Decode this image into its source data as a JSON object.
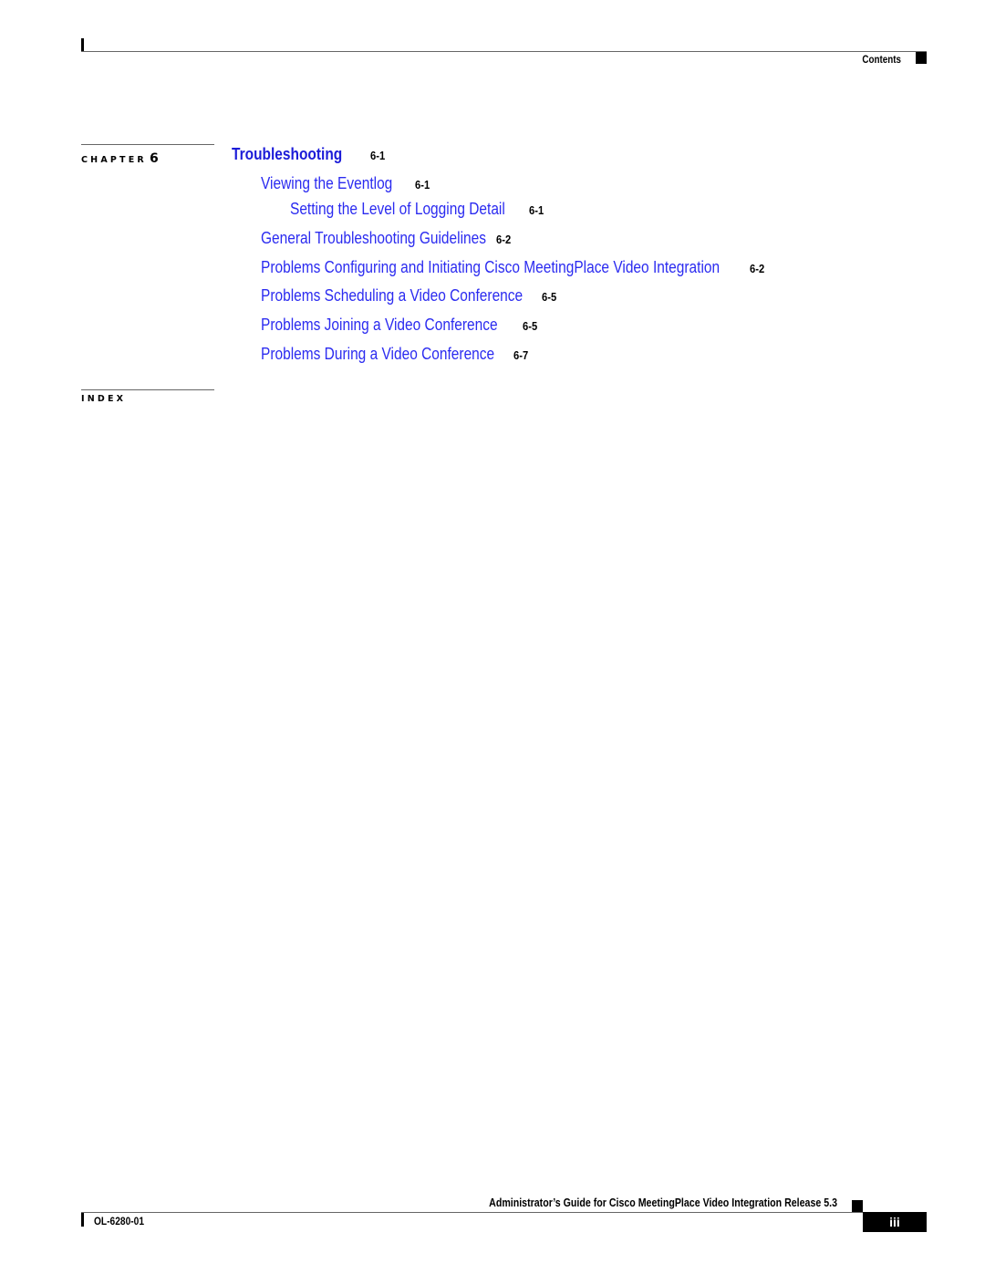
{
  "header": {
    "section_label": "Contents"
  },
  "chapter": {
    "label": "CHAPTER",
    "number": "6"
  },
  "toc": [
    {
      "level": 0,
      "title": "Troubleshooting",
      "page": "6-1"
    },
    {
      "level": 1,
      "title": "Viewing the Eventlog",
      "page": "6-1"
    },
    {
      "level": 2,
      "title": "Setting the Level of Logging Detail",
      "page": "6-1"
    },
    {
      "level": 1,
      "title": "General Troubleshooting Guidelines",
      "page": "6-2"
    },
    {
      "level": 1,
      "title": "Problems Configuring and Initiating Cisco MeetingPlace Video Integration",
      "page": "6-2"
    },
    {
      "level": 1,
      "title": "Problems Scheduling a Video Conference",
      "page": "6-5"
    },
    {
      "level": 1,
      "title": "Problems Joining a Video Conference",
      "page": "6-5"
    },
    {
      "level": 1,
      "title": "Problems During a Video Conference",
      "page": "6-7"
    }
  ],
  "index": {
    "label": "INDEX"
  },
  "footer": {
    "guide_title": "Administrator’s Guide for Cisco MeetingPlace Video Integration Release 5.3",
    "doc_number": "OL-6280-01",
    "page_number": "iii"
  },
  "colors": {
    "link": "#2b2bf0",
    "heading_link": "#1c1cd8",
    "text": "#000000",
    "rule": "#666666"
  }
}
